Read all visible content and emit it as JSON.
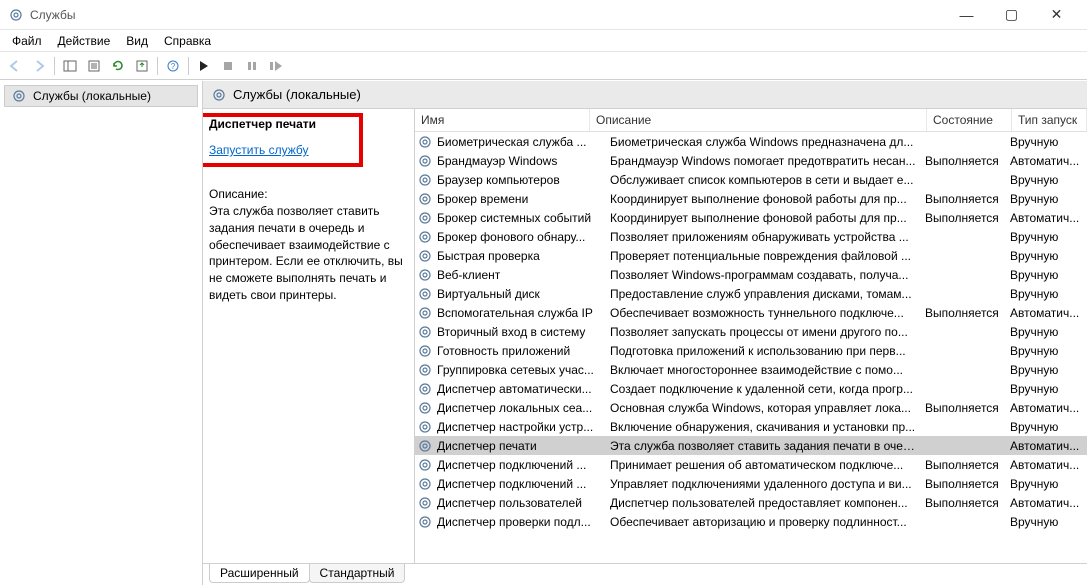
{
  "window": {
    "title": "Службы"
  },
  "menu": {
    "file": "Файл",
    "action": "Действие",
    "view": "Вид",
    "help": "Справка"
  },
  "tree": {
    "root": "Службы (локальные)"
  },
  "content_header": "Службы (локальные)",
  "detail": {
    "title": "Диспетчер печати",
    "start_link": "Запустить службу",
    "desc_label": "Описание:",
    "description": "Эта служба позволяет ставить задания печати в очередь и обеспечивает взаимодействие с принтером. Если ее отключить, вы не сможете выполнять печать и видеть свои принтеры."
  },
  "columns": {
    "name": "Имя",
    "desc": "Описание",
    "state": "Состояние",
    "type": "Тип запуск"
  },
  "services": [
    {
      "name": "Биометрическая служба ...",
      "desc": "Биометрическая служба Windows предназначена дл...",
      "state": "",
      "type": "Вручную"
    },
    {
      "name": "Брандмауэр Windows",
      "desc": "Брандмауэр Windows помогает предотвратить несан...",
      "state": "Выполняется",
      "type": "Автоматич..."
    },
    {
      "name": "Браузер компьютеров",
      "desc": "Обслуживает список компьютеров в сети и выдает е...",
      "state": "",
      "type": "Вручную"
    },
    {
      "name": "Брокер времени",
      "desc": "Координирует выполнение фоновой работы для пр...",
      "state": "Выполняется",
      "type": "Вручную"
    },
    {
      "name": "Брокер системных событий",
      "desc": "Координирует выполнение фоновой работы для пр...",
      "state": "Выполняется",
      "type": "Автоматич..."
    },
    {
      "name": "Брокер фонового обнару...",
      "desc": "Позволяет приложениям обнаруживать устройства ...",
      "state": "",
      "type": "Вручную"
    },
    {
      "name": "Быстрая проверка",
      "desc": "Проверяет потенциальные повреждения файловой ...",
      "state": "",
      "type": "Вручную"
    },
    {
      "name": "Веб-клиент",
      "desc": "Позволяет Windows-программам создавать, получа...",
      "state": "",
      "type": "Вручную"
    },
    {
      "name": "Виртуальный диск",
      "desc": "Предоставление служб управления дисками, томам...",
      "state": "",
      "type": "Вручную"
    },
    {
      "name": "Вспомогательная служба IP",
      "desc": "Обеспечивает возможность туннельного подключе...",
      "state": "Выполняется",
      "type": "Автоматич..."
    },
    {
      "name": "Вторичный вход в систему",
      "desc": "Позволяет запускать процессы от имени другого по...",
      "state": "",
      "type": "Вручную"
    },
    {
      "name": "Готовность приложений",
      "desc": "Подготовка приложений к использованию при перв...",
      "state": "",
      "type": "Вручную"
    },
    {
      "name": "Группировка сетевых учас...",
      "desc": "Включает многостороннее взаимодействие с помо...",
      "state": "",
      "type": "Вручную"
    },
    {
      "name": "Диспетчер автоматически...",
      "desc": "Создает подключение к удаленной сети, когда прогр...",
      "state": "",
      "type": "Вручную"
    },
    {
      "name": "Диспетчер локальных сеа...",
      "desc": "Основная служба Windows, которая управляет лока...",
      "state": "Выполняется",
      "type": "Автоматич..."
    },
    {
      "name": "Диспетчер настройки устр...",
      "desc": "Включение обнаружения, скачивания и установки пр...",
      "state": "",
      "type": "Вручную"
    },
    {
      "name": "Диспетчер печати",
      "desc": "Эта служба позволяет ставить задания печати в очер...",
      "state": "",
      "type": "Автоматич...",
      "selected": true
    },
    {
      "name": "Диспетчер подключений ...",
      "desc": "Принимает решения об автоматическом подключе...",
      "state": "Выполняется",
      "type": "Автоматич..."
    },
    {
      "name": "Диспетчер подключений ...",
      "desc": "Управляет подключениями удаленного доступа и ви...",
      "state": "Выполняется",
      "type": "Вручную"
    },
    {
      "name": "Диспетчер пользователей",
      "desc": "Диспетчер пользователей предоставляет компонен...",
      "state": "Выполняется",
      "type": "Автоматич..."
    },
    {
      "name": "Диспетчер проверки подл...",
      "desc": "Обеспечивает авторизацию и проверку подлинност...",
      "state": "",
      "type": "Вручную"
    }
  ],
  "tabs": {
    "extended": "Расширенный",
    "standard": "Стандартный"
  }
}
